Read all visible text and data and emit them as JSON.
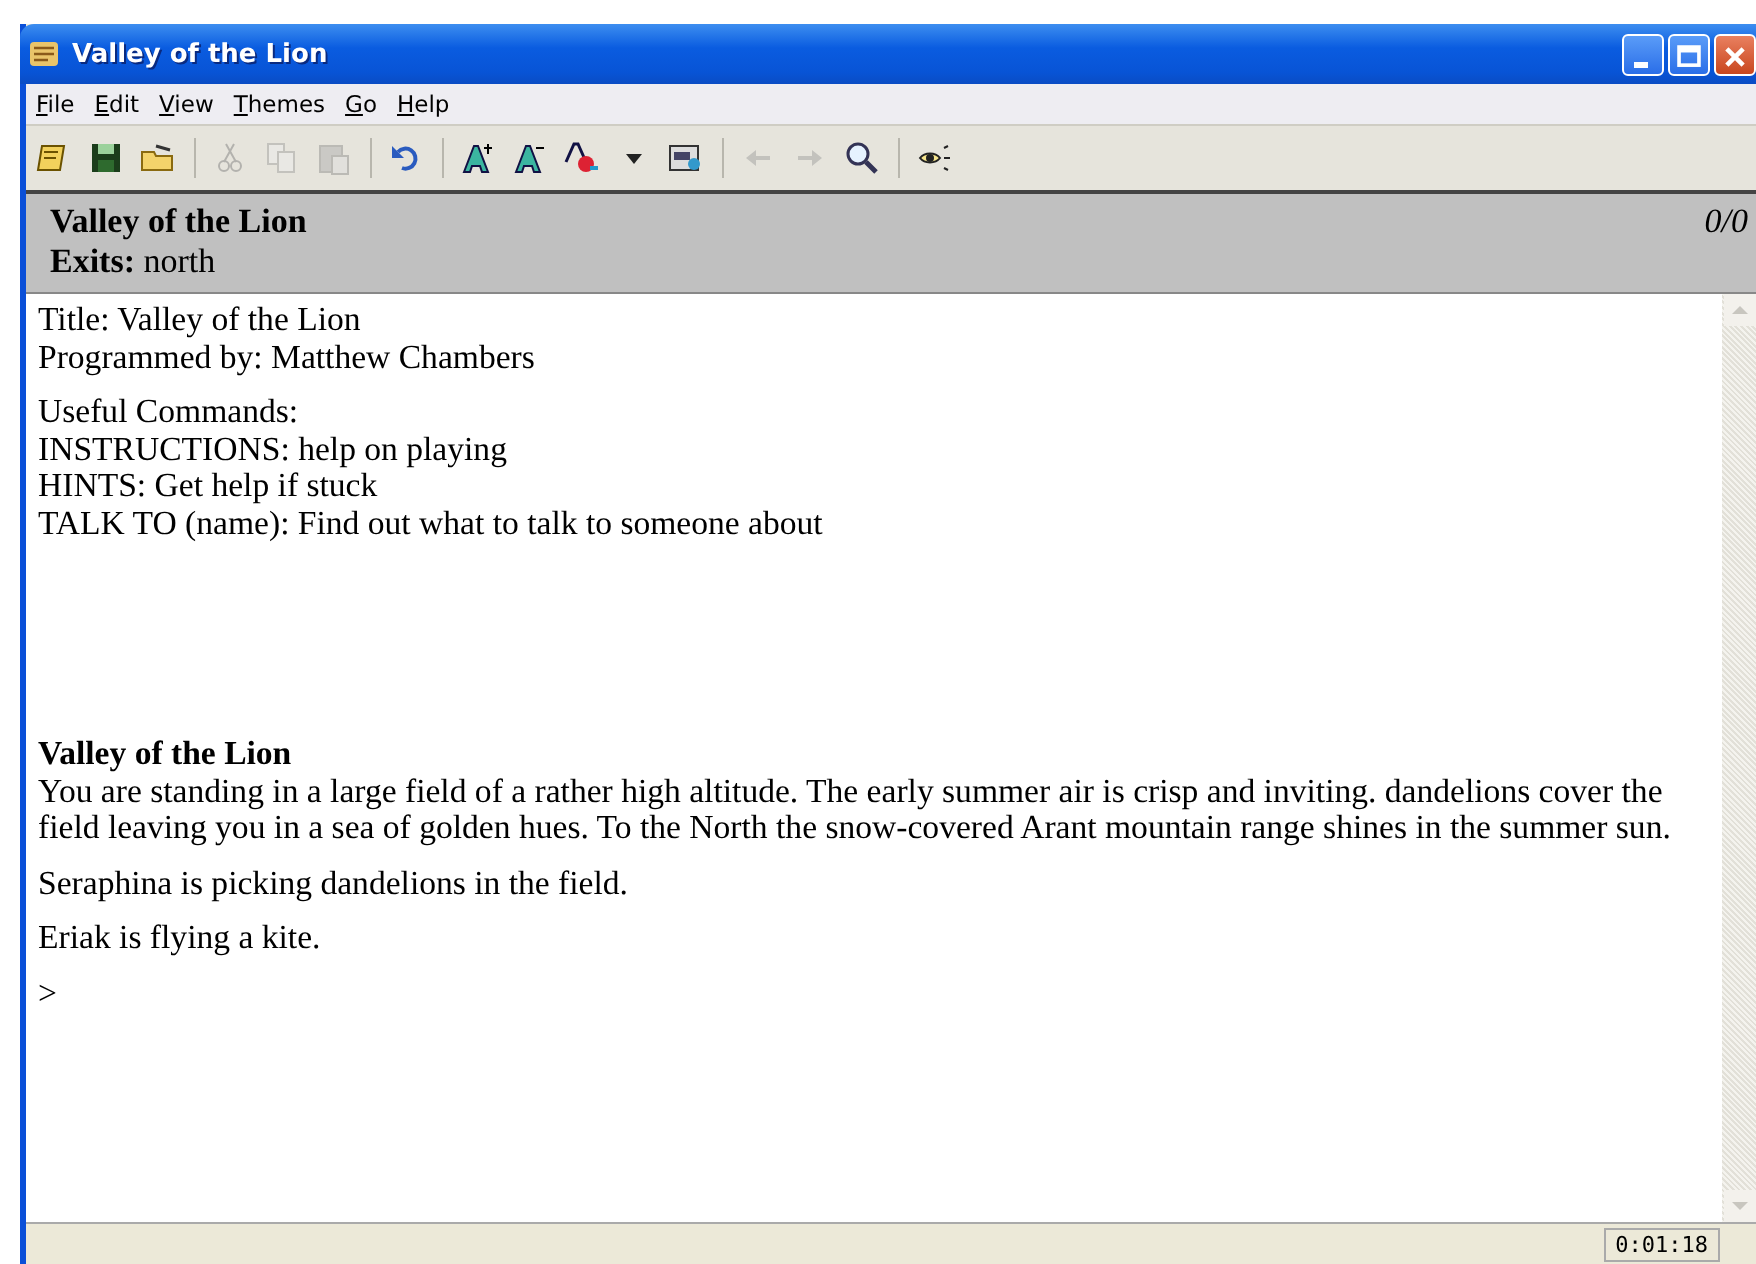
{
  "window": {
    "title": "Valley of the Lion"
  },
  "menu": [
    "File",
    "Edit",
    "View",
    "Themes",
    "Go",
    "Help"
  ],
  "toolbar": [
    {
      "kind": "button",
      "disabled": false
    },
    {
      "kind": "button",
      "disabled": false
    },
    {
      "kind": "button",
      "disabled": false
    },
    {
      "kind": "separator"
    },
    {
      "kind": "button",
      "disabled": true
    },
    {
      "kind": "button",
      "disabled": true
    },
    {
      "kind": "button",
      "disabled": true
    },
    {
      "kind": "separator"
    },
    {
      "kind": "button",
      "disabled": false
    },
    {
      "kind": "separator"
    },
    {
      "kind": "button",
      "disabled": false
    },
    {
      "kind": "button",
      "disabled": false
    },
    {
      "kind": "button",
      "disabled": false
    },
    {
      "kind": "button",
      "disabled": false
    },
    {
      "kind": "button",
      "disabled": false
    },
    {
      "kind": "separator"
    },
    {
      "kind": "button",
      "disabled": true
    },
    {
      "kind": "button",
      "disabled": true
    },
    {
      "kind": "button",
      "disabled": false
    },
    {
      "kind": "separator"
    },
    {
      "kind": "button",
      "disabled": false
    }
  ],
  "header": {
    "location": "Valley of the Lion",
    "exits_label": "Exits:",
    "exits": "north",
    "score": "0/0"
  },
  "transcript": [
    {
      "kind": "block",
      "lines": [
        "Title: Valley of the Lion",
        "Programmed by: Matthew Chambers"
      ]
    },
    {
      "kind": "block",
      "lines": [
        "Useful Commands:",
        "INSTRUCTIONS: help on playing",
        "HINTS: Get help if stuck",
        "TALK TO (name): Find out what to talk to someone about"
      ]
    },
    {
      "kind": "spacer"
    },
    {
      "kind": "room",
      "title": "Valley of the Lion",
      "text": "You are standing in a large field of a rather high altitude.  The early summer air is crisp and inviting. dandelions cover the field leaving you in a sea of golden hues.  To the North the snow-covered Arant mountain range shines in the summer sun."
    },
    {
      "kind": "para",
      "text": "Seraphina is picking dandelions in the field."
    },
    {
      "kind": "para",
      "text": "Eriak is flying a kite."
    },
    {
      "kind": "prompt",
      "text": ">"
    }
  ],
  "status_bar": {
    "time": "0:01:18"
  }
}
